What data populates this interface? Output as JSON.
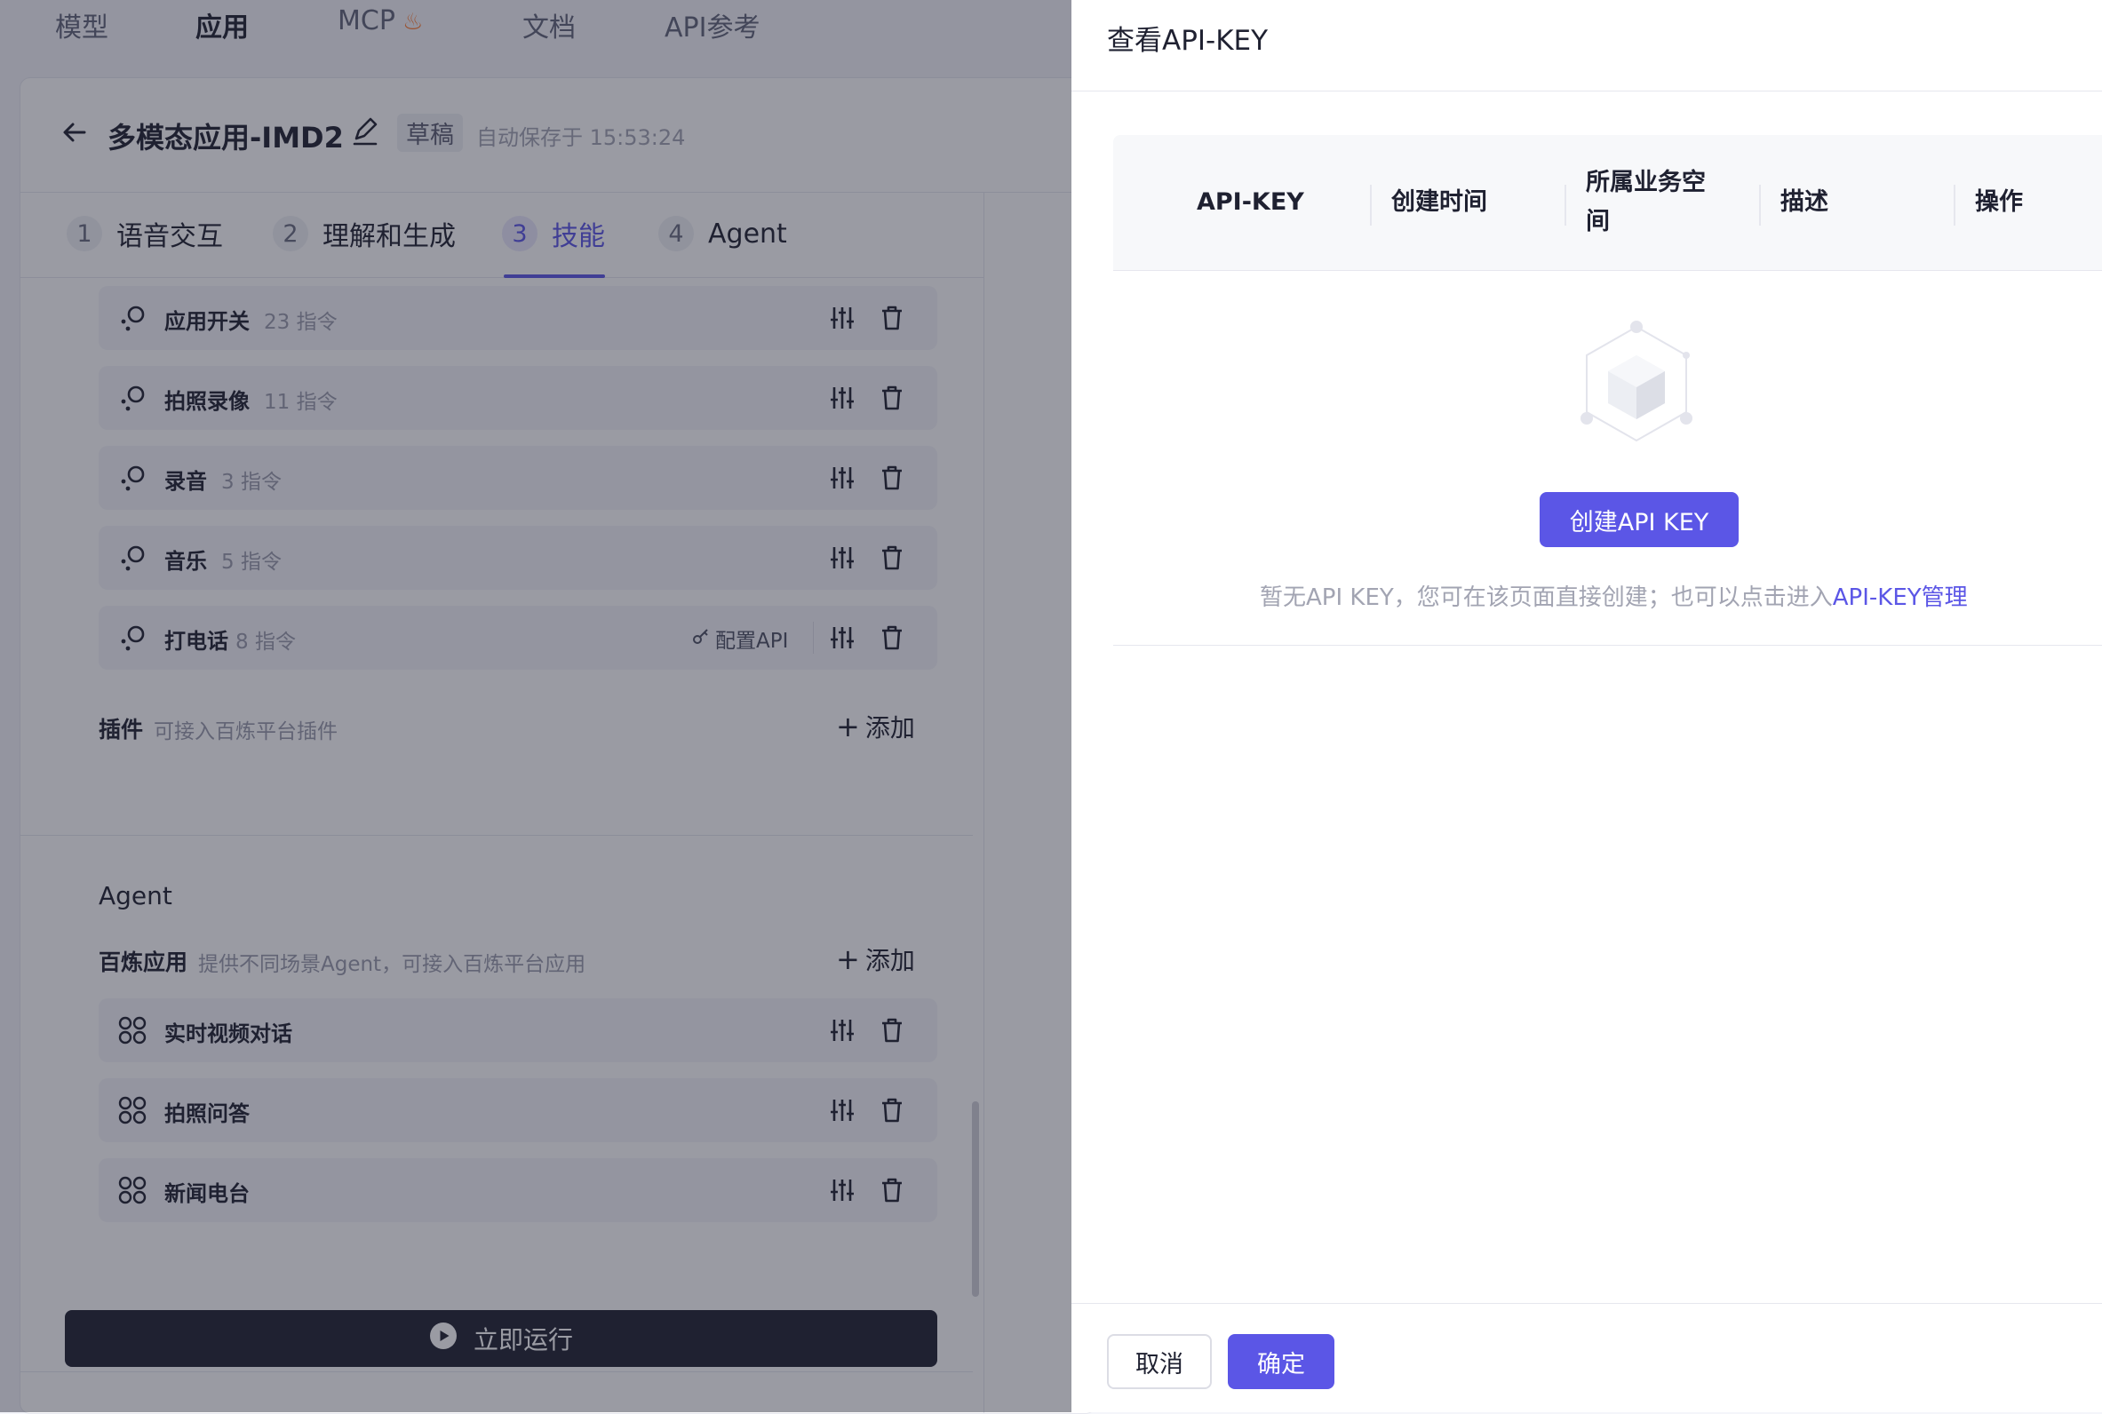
{
  "nav": {
    "items": [
      {
        "label": "模型"
      },
      {
        "label": "应用"
      },
      {
        "label": "MCP"
      },
      {
        "label": "文档"
      },
      {
        "label": "API参考"
      }
    ]
  },
  "app": {
    "title": "多模态应用-IMD2",
    "status_badge": "草稿",
    "autosave": "自动保存于 15:53:24"
  },
  "steps": [
    {
      "num": "1",
      "label": "语音交互"
    },
    {
      "num": "2",
      "label": "理解和生成"
    },
    {
      "num": "3",
      "label": "技能"
    },
    {
      "num": "4",
      "label": "Agent"
    }
  ],
  "skills": [
    {
      "name": "应用开关",
      "count": "23 指令"
    },
    {
      "name": "拍照录像",
      "count": "11 指令"
    },
    {
      "name": "录音",
      "count": "3 指令"
    },
    {
      "name": "音乐",
      "count": "5 指令"
    },
    {
      "name": "打电话",
      "count": "8 指令",
      "config_label": "配置API"
    }
  ],
  "plugins": {
    "label": "插件",
    "desc": "可接入百炼平台插件",
    "add_label": "添加"
  },
  "agent_section": {
    "heading": "Agent",
    "label": "百炼应用",
    "desc": "提供不同场景Agent，可接入百炼平台应用",
    "add_label": "添加",
    "items": [
      {
        "name": "实时视频对话"
      },
      {
        "name": "拍照问答"
      },
      {
        "name": "新闻电台"
      }
    ]
  },
  "run_button": "立即运行",
  "drawer": {
    "title": "查看API-KEY",
    "columns": [
      "API-KEY",
      "创建时间",
      "所属业务空",
      "间",
      "描述",
      "操作"
    ],
    "create_button": "创建API KEY",
    "empty_text": "暂无API KEY，您可在该页面直接创建；也可以点击进入",
    "empty_link": "API-KEY管理",
    "cancel": "取消",
    "confirm": "确定"
  },
  "colors": {
    "accent": "#5b56e6",
    "dark": "#1f2131",
    "muted": "#9a9cab"
  }
}
